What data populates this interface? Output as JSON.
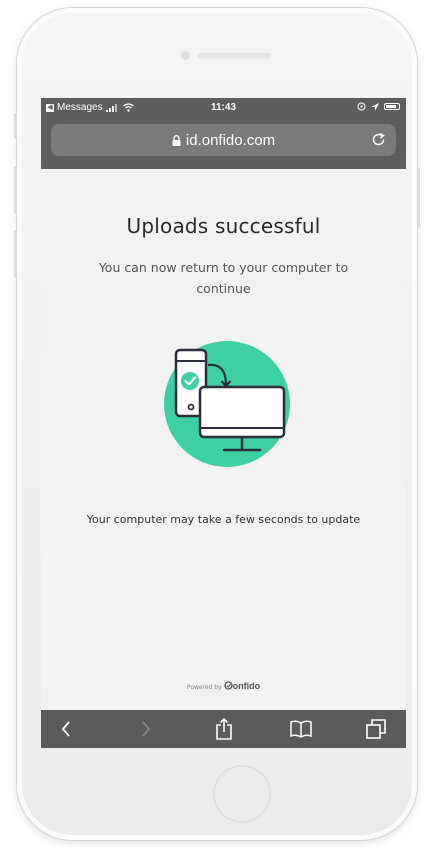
{
  "status_bar": {
    "back_app": "Messages",
    "time": "11:43"
  },
  "browser": {
    "url": "id.onfido.com"
  },
  "page": {
    "title": "Uploads successful",
    "subtitle": "You can now return to your computer to continue",
    "note": "Your computer may take a few seconds to update",
    "powered_by": "Powered by",
    "brand": "onfido"
  },
  "colors": {
    "accent": "#3ecfa2",
    "toolbar": "#5b5b5b"
  },
  "icons": {
    "back": "chevron-left",
    "forward": "chevron-right",
    "share": "share",
    "bookmarks": "book",
    "tabs": "tabs"
  }
}
